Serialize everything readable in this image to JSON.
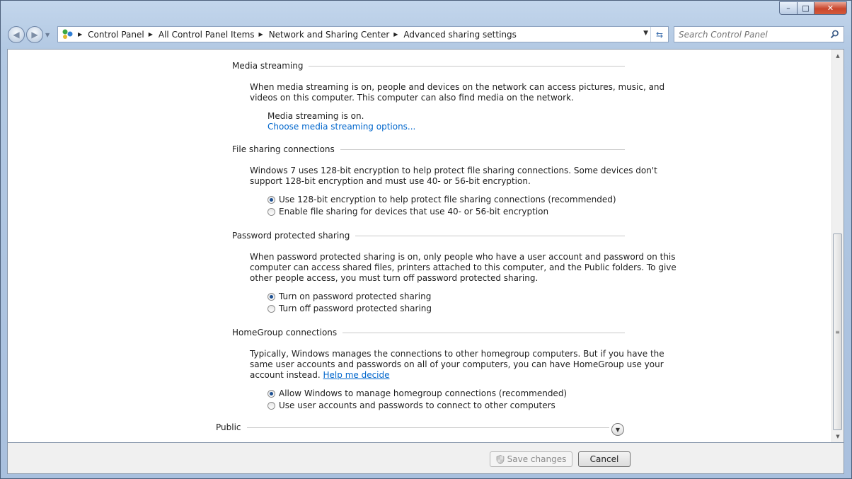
{
  "window": {
    "minimize_icon": "minimize-icon",
    "maximize_icon": "maximize-icon",
    "close_icon": "close-icon"
  },
  "address_bar": {
    "breadcrumbs": [
      "Control Panel",
      "All Control Panel Items",
      "Network and Sharing Center",
      "Advanced sharing settings"
    ]
  },
  "search": {
    "placeholder": "Search Control Panel"
  },
  "sections": {
    "media": {
      "title": "Media streaming",
      "description": [
        "When media streaming is on, people and devices on the network can access pictures, music, and",
        "videos on this computer. This computer can also find media on the network."
      ],
      "status": "Media streaming is on.",
      "link": "Choose media streaming options..."
    },
    "file_sharing": {
      "title": "File sharing connections",
      "description": [
        "Windows 7 uses 128-bit encryption to help protect file sharing connections. Some devices don't",
        "support 128-bit encryption and must use 40- or 56-bit encryption."
      ],
      "options": [
        {
          "label": "Use 128-bit encryption to help protect file sharing connections (recommended)",
          "selected": true
        },
        {
          "label": "Enable file sharing for devices that use 40- or 56-bit encryption",
          "selected": false
        }
      ]
    },
    "password": {
      "title": "Password protected sharing",
      "description": [
        "When password protected sharing is on, only people who have a user account and password on this",
        "computer can access shared files, printers attached to this computer, and the Public folders. To give",
        "other people access, you must turn off password protected sharing."
      ],
      "options": [
        {
          "label": "Turn on password protected sharing",
          "selected": true
        },
        {
          "label": "Turn off password protected sharing",
          "selected": false
        }
      ]
    },
    "homegroup": {
      "title": "HomeGroup connections",
      "description": [
        "Typically, Windows manages the connections to other homegroup computers. But if you have the",
        "same user accounts and passwords on all of your computers, you can have HomeGroup use your",
        "account instead."
      ],
      "help_link": "Help me decide",
      "options": [
        {
          "label": "Allow Windows to manage homegroup connections (recommended)",
          "selected": true
        },
        {
          "label": "Use user accounts and passwords to connect to other computers",
          "selected": false
        }
      ]
    },
    "public": {
      "title": "Public"
    }
  },
  "buttons": {
    "save": "Save changes",
    "cancel": "Cancel"
  }
}
